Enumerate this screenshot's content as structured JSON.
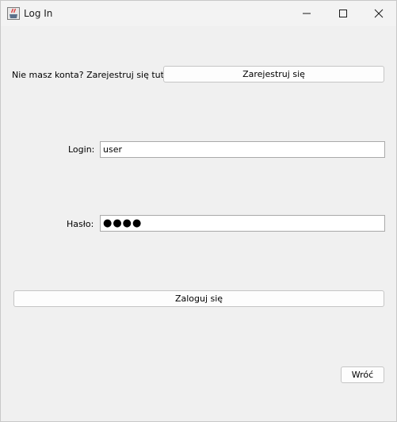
{
  "window": {
    "title": "Log In",
    "app_icon": "java-cup-icon",
    "controls": {
      "minimize_icon": "minimize-icon",
      "maximize_icon": "maximize-icon",
      "close_icon": "close-icon"
    }
  },
  "register": {
    "prompt": "Nie masz konta? Zarejestruj się tutaj:",
    "button_label": "Zarejestruj się"
  },
  "login": {
    "label": "Login:",
    "value": "user"
  },
  "password": {
    "label": "Hasło:",
    "masked_value": "●●●●"
  },
  "actions": {
    "login_button": "Zaloguj się",
    "back_button": "Wróć"
  }
}
